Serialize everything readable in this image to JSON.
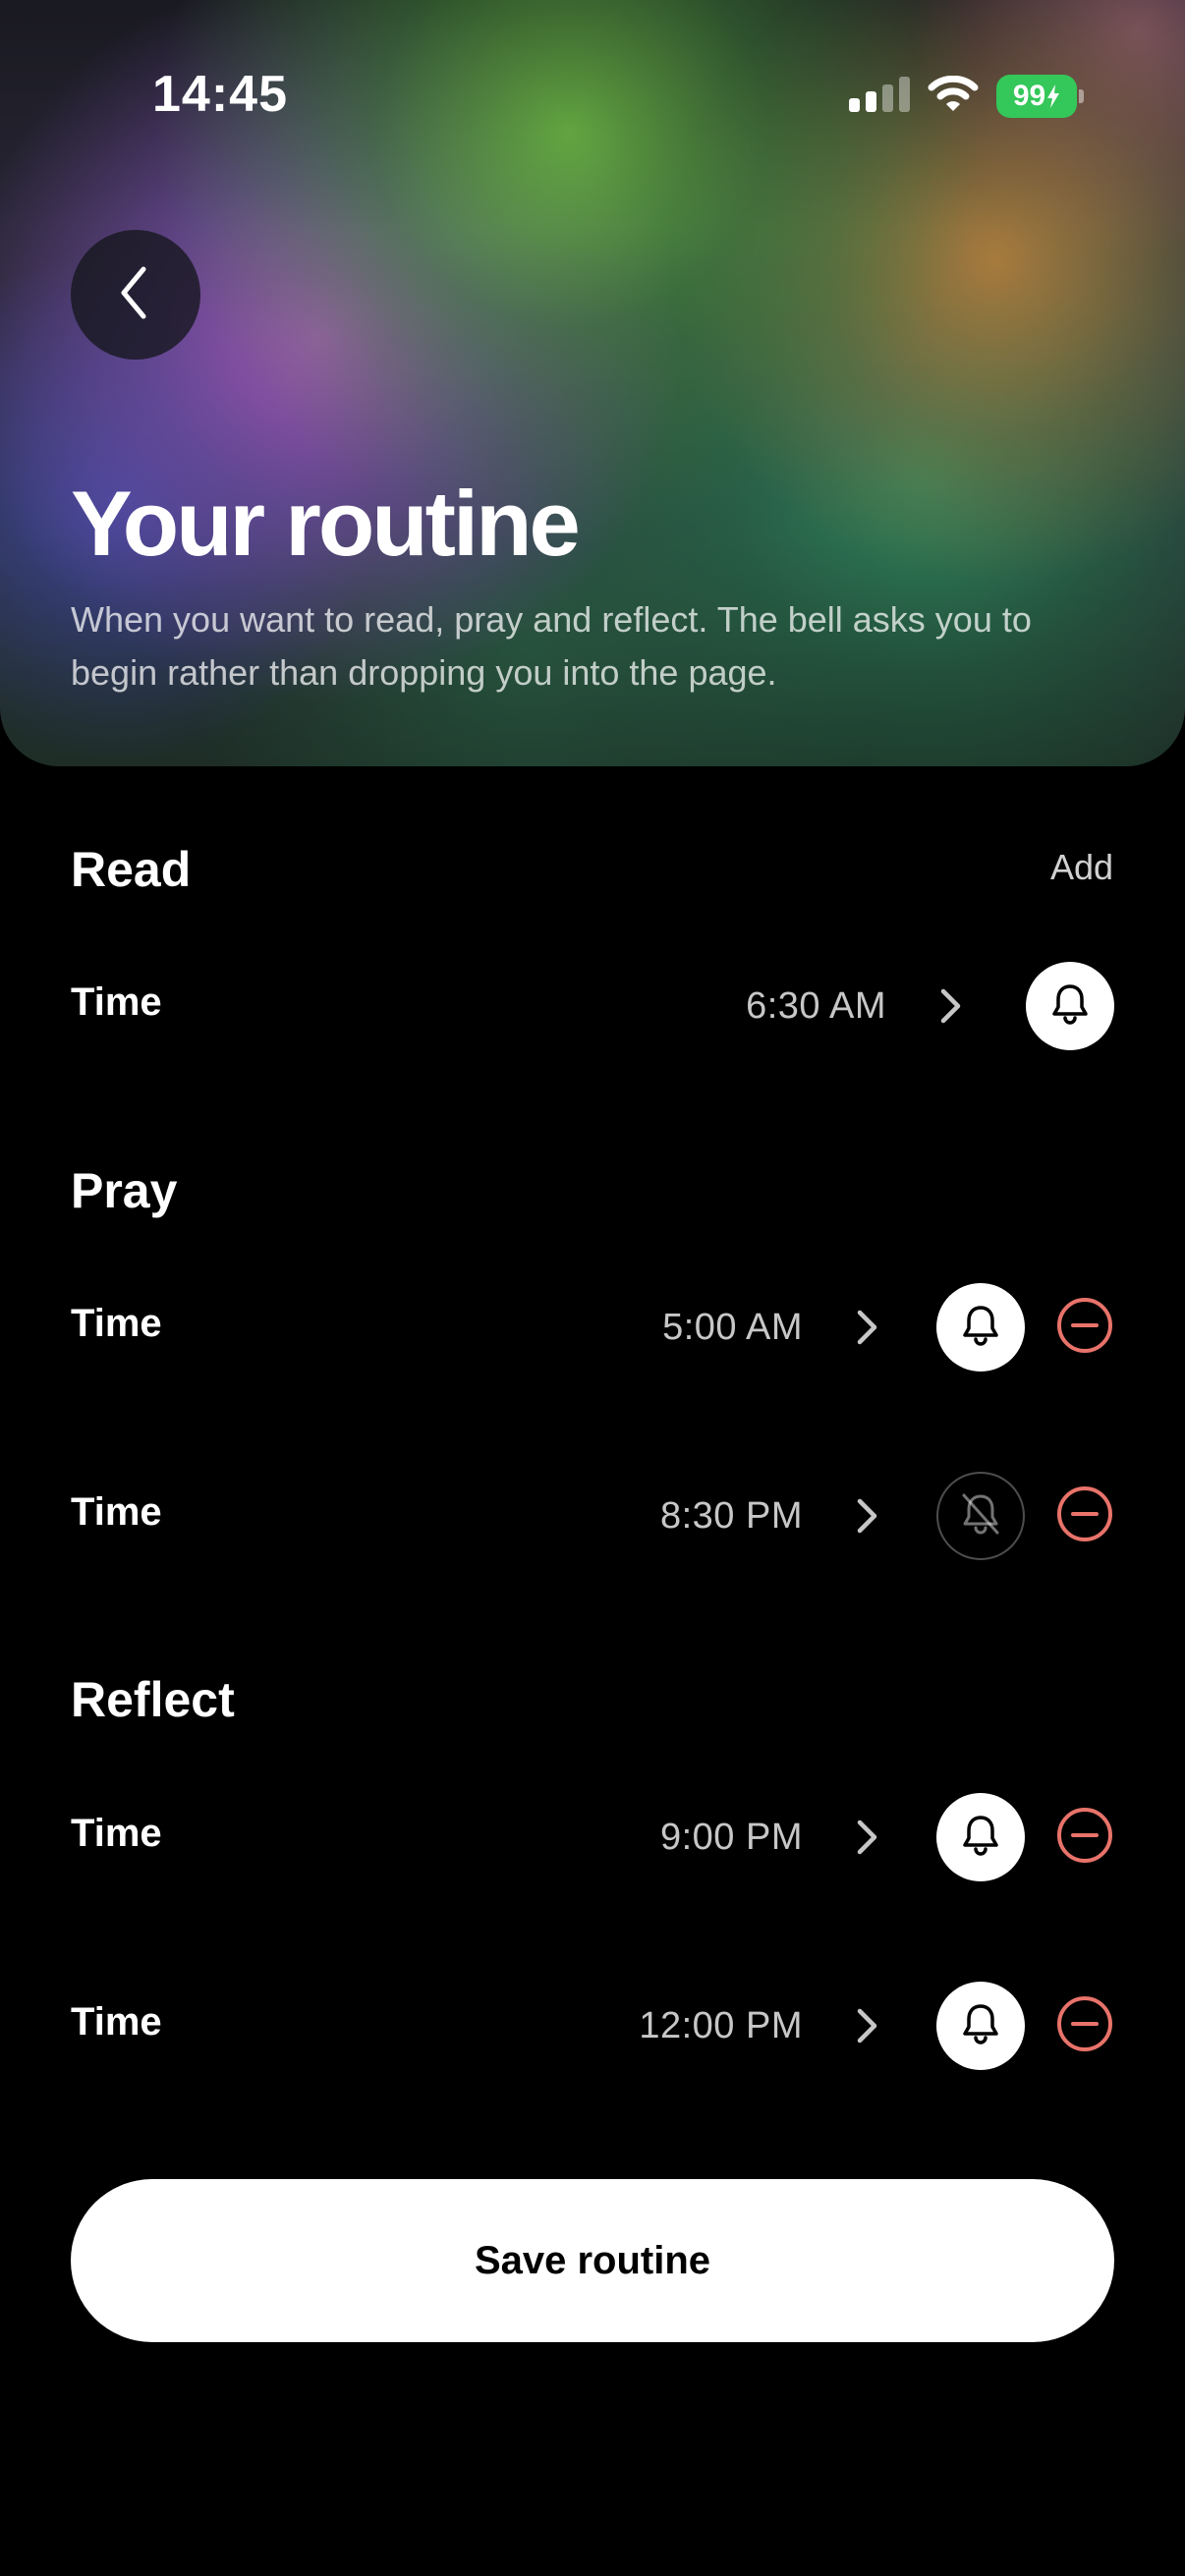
{
  "status_bar": {
    "time": "14:45",
    "battery": "99",
    "icons": [
      "signal-icon",
      "wifi-icon",
      "battery-charging-icon"
    ]
  },
  "header": {
    "back_icon": "chevron-left-icon",
    "title": "Your routine",
    "subtitle": "When you want to read, pray and reflect. The bell asks you to begin rather than dropping you into the page."
  },
  "sections": {
    "read": {
      "title": "Read",
      "add_label": "Add",
      "rows": [
        {
          "label": "Time",
          "time": "6:30 AM",
          "bell_on": true
        }
      ]
    },
    "pray": {
      "title": "Pray",
      "rows": [
        {
          "label": "Time",
          "time": "5:00 AM",
          "bell_on": true
        },
        {
          "label": "Time",
          "time": "8:30 PM",
          "bell_on": false
        }
      ]
    },
    "reflect": {
      "title": "Reflect",
      "rows": [
        {
          "label": "Time",
          "time": "9:00 PM",
          "bell_on": true
        },
        {
          "label": "Time",
          "time": "12:00 PM",
          "bell_on": true
        }
      ]
    }
  },
  "save_button": {
    "label": "Save routine"
  },
  "colors": {
    "background": "#000000",
    "battery": "#34c759",
    "remove_accent": "#e8736a",
    "button": "#ffffff"
  }
}
